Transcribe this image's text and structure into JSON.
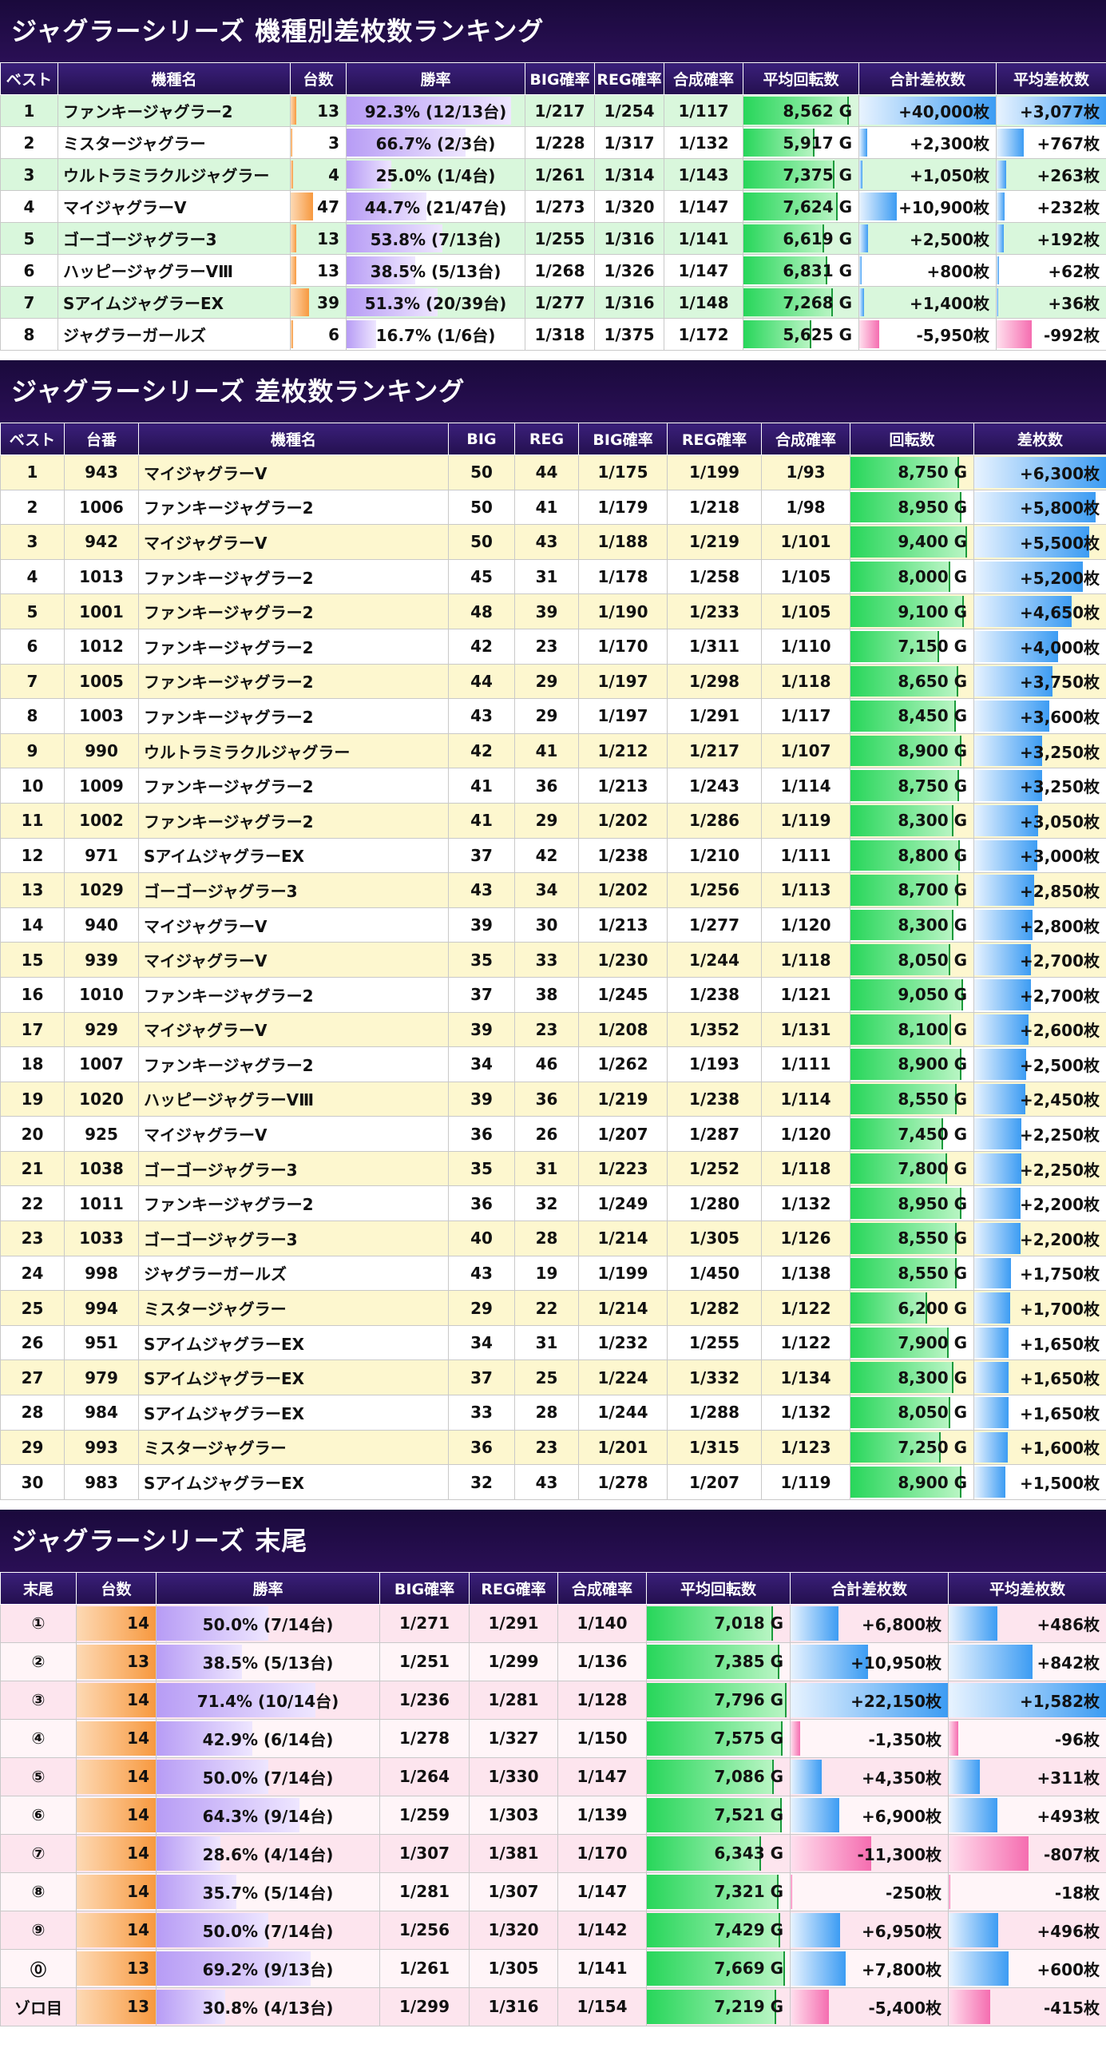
{
  "section1": {
    "title": "ジャグラーシリーズ 機種別差枚数ランキング",
    "headers": [
      "ベスト",
      "機種名",
      "台数",
      "勝率",
      "BIG確率",
      "REG確率",
      "合成確率",
      "平均回転数",
      "合計差枚数",
      "平均差枚数"
    ],
    "rows": [
      {
        "rank": "1",
        "name": "ファンキージャグラー2",
        "count": "13",
        "count_pct": 10,
        "win": "92.3% (12/13台)",
        "win_pct": 92.3,
        "big": "1/217",
        "reg": "1/254",
        "comb": "1/117",
        "avg_spin": "8,562 G",
        "spin_pct": 92,
        "total": "+40,000枚",
        "total_val": 40000,
        "avg": "+3,077枚",
        "avg_val": 3077
      },
      {
        "rank": "2",
        "name": "ミスタージャグラー",
        "count": "3",
        "count_pct": 3,
        "win": "66.7% (2/3台)",
        "win_pct": 66.7,
        "big": "1/228",
        "reg": "1/317",
        "comb": "1/132",
        "avg_spin": "5,917 G",
        "spin_pct": 62,
        "total": "+2,300枚",
        "total_val": 2300,
        "avg": "+767枚",
        "avg_val": 767
      },
      {
        "rank": "3",
        "name": "ウルトラミラクルジャグラー",
        "count": "4",
        "count_pct": 4,
        "win": "25.0% (1/4台)",
        "win_pct": 25,
        "big": "1/261",
        "reg": "1/314",
        "comb": "1/143",
        "avg_spin": "7,375 G",
        "spin_pct": 79,
        "total": "+1,050枚",
        "total_val": 1050,
        "avg": "+263枚",
        "avg_val": 263
      },
      {
        "rank": "4",
        "name": "マイジャグラーV",
        "count": "47",
        "count_pct": 40,
        "win": "44.7% (21/47台)",
        "win_pct": 44.7,
        "big": "1/273",
        "reg": "1/320",
        "comb": "1/147",
        "avg_spin": "7,624 G",
        "spin_pct": 82,
        "total": "+10,900枚",
        "total_val": 10900,
        "avg": "+232枚",
        "avg_val": 232
      },
      {
        "rank": "5",
        "name": "ゴーゴージャグラー3",
        "count": "13",
        "count_pct": 10,
        "win": "53.8% (7/13台)",
        "win_pct": 53.8,
        "big": "1/255",
        "reg": "1/316",
        "comb": "1/141",
        "avg_spin": "6,619 G",
        "spin_pct": 70,
        "total": "+2,500枚",
        "total_val": 2500,
        "avg": "+192枚",
        "avg_val": 192
      },
      {
        "rank": "6",
        "name": "ハッピージャグラーVⅢ",
        "count": "13",
        "count_pct": 10,
        "win": "38.5% (5/13台)",
        "win_pct": 38.5,
        "big": "1/268",
        "reg": "1/326",
        "comb": "1/147",
        "avg_spin": "6,831 G",
        "spin_pct": 73,
        "total": "+800枚",
        "total_val": 800,
        "avg": "+62枚",
        "avg_val": 62
      },
      {
        "rank": "7",
        "name": "SアイムジャグラーEX",
        "count": "39",
        "count_pct": 33,
        "win": "51.3% (20/39台)",
        "win_pct": 51.3,
        "big": "1/277",
        "reg": "1/316",
        "comb": "1/148",
        "avg_spin": "7,268 G",
        "spin_pct": 78,
        "total": "+1,400枚",
        "total_val": 1400,
        "avg": "+36枚",
        "avg_val": 36
      },
      {
        "rank": "8",
        "name": "ジャグラーガールズ",
        "count": "6",
        "count_pct": 5,
        "win": "16.7% (1/6台)",
        "win_pct": 16.7,
        "big": "1/318",
        "reg": "1/375",
        "comb": "1/172",
        "avg_spin": "5,625 G",
        "spin_pct": 59,
        "total": "-5,950枚",
        "total_val": -5950,
        "avg": "-992枚",
        "avg_val": -992
      }
    ]
  },
  "section2": {
    "title": "ジャグラーシリーズ 差枚数ランキング",
    "headers": [
      "ベスト",
      "台番",
      "機種名",
      "BIG",
      "REG",
      "BIG確率",
      "REG確率",
      "合成確率",
      "回転数",
      "差枚数"
    ],
    "rows": [
      {
        "rank": "1",
        "machine": "943",
        "name": "マイジャグラーV",
        "big": "50",
        "reg": "44",
        "bigp": "1/175",
        "regp": "1/199",
        "comb": "1/93",
        "spin": "8,750 G",
        "spin_val": 8750,
        "diff": "+6,300枚",
        "diff_val": 6300
      },
      {
        "rank": "2",
        "machine": "1006",
        "name": "ファンキージャグラー2",
        "big": "50",
        "reg": "41",
        "bigp": "1/179",
        "regp": "1/218",
        "comb": "1/98",
        "spin": "8,950 G",
        "spin_val": 8950,
        "diff": "+5,800枚",
        "diff_val": 5800
      },
      {
        "rank": "3",
        "machine": "942",
        "name": "マイジャグラーV",
        "big": "50",
        "reg": "43",
        "bigp": "1/188",
        "regp": "1/219",
        "comb": "1/101",
        "spin": "9,400 G",
        "spin_val": 9400,
        "diff": "+5,500枚",
        "diff_val": 5500
      },
      {
        "rank": "4",
        "machine": "1013",
        "name": "ファンキージャグラー2",
        "big": "45",
        "reg": "31",
        "bigp": "1/178",
        "regp": "1/258",
        "comb": "1/105",
        "spin": "8,000 G",
        "spin_val": 8000,
        "diff": "+5,200枚",
        "diff_val": 5200
      },
      {
        "rank": "5",
        "machine": "1001",
        "name": "ファンキージャグラー2",
        "big": "48",
        "reg": "39",
        "bigp": "1/190",
        "regp": "1/233",
        "comb": "1/105",
        "spin": "9,100 G",
        "spin_val": 9100,
        "diff": "+4,650枚",
        "diff_val": 4650
      },
      {
        "rank": "6",
        "machine": "1012",
        "name": "ファンキージャグラー2",
        "big": "42",
        "reg": "23",
        "bigp": "1/170",
        "regp": "1/311",
        "comb": "1/110",
        "spin": "7,150 G",
        "spin_val": 7150,
        "diff": "+4,000枚",
        "diff_val": 4000
      },
      {
        "rank": "7",
        "machine": "1005",
        "name": "ファンキージャグラー2",
        "big": "44",
        "reg": "29",
        "bigp": "1/197",
        "regp": "1/298",
        "comb": "1/118",
        "spin": "8,650 G",
        "spin_val": 8650,
        "diff": "+3,750枚",
        "diff_val": 3750
      },
      {
        "rank": "8",
        "machine": "1003",
        "name": "ファンキージャグラー2",
        "big": "43",
        "reg": "29",
        "bigp": "1/197",
        "regp": "1/291",
        "comb": "1/117",
        "spin": "8,450 G",
        "spin_val": 8450,
        "diff": "+3,600枚",
        "diff_val": 3600
      },
      {
        "rank": "9",
        "machine": "990",
        "name": "ウルトラミラクルジャグラー",
        "big": "42",
        "reg": "41",
        "bigp": "1/212",
        "regp": "1/217",
        "comb": "1/107",
        "spin": "8,900 G",
        "spin_val": 8900,
        "diff": "+3,250枚",
        "diff_val": 3250
      },
      {
        "rank": "10",
        "machine": "1009",
        "name": "ファンキージャグラー2",
        "big": "41",
        "reg": "36",
        "bigp": "1/213",
        "regp": "1/243",
        "comb": "1/114",
        "spin": "8,750 G",
        "spin_val": 8750,
        "diff": "+3,250枚",
        "diff_val": 3250
      },
      {
        "rank": "11",
        "machine": "1002",
        "name": "ファンキージャグラー2",
        "big": "41",
        "reg": "29",
        "bigp": "1/202",
        "regp": "1/286",
        "comb": "1/119",
        "spin": "8,300 G",
        "spin_val": 8300,
        "diff": "+3,050枚",
        "diff_val": 3050
      },
      {
        "rank": "12",
        "machine": "971",
        "name": "SアイムジャグラーEX",
        "big": "37",
        "reg": "42",
        "bigp": "1/238",
        "regp": "1/210",
        "comb": "1/111",
        "spin": "8,800 G",
        "spin_val": 8800,
        "diff": "+3,000枚",
        "diff_val": 3000
      },
      {
        "rank": "13",
        "machine": "1029",
        "name": "ゴーゴージャグラー3",
        "big": "43",
        "reg": "34",
        "bigp": "1/202",
        "regp": "1/256",
        "comb": "1/113",
        "spin": "8,700 G",
        "spin_val": 8700,
        "diff": "+2,850枚",
        "diff_val": 2850
      },
      {
        "rank": "14",
        "machine": "940",
        "name": "マイジャグラーV",
        "big": "39",
        "reg": "30",
        "bigp": "1/213",
        "regp": "1/277",
        "comb": "1/120",
        "spin": "8,300 G",
        "spin_val": 8300,
        "diff": "+2,800枚",
        "diff_val": 2800
      },
      {
        "rank": "15",
        "machine": "939",
        "name": "マイジャグラーV",
        "big": "35",
        "reg": "33",
        "bigp": "1/230",
        "regp": "1/244",
        "comb": "1/118",
        "spin": "8,050 G",
        "spin_val": 8050,
        "diff": "+2,700枚",
        "diff_val": 2700
      },
      {
        "rank": "16",
        "machine": "1010",
        "name": "ファンキージャグラー2",
        "big": "37",
        "reg": "38",
        "bigp": "1/245",
        "regp": "1/238",
        "comb": "1/121",
        "spin": "9,050 G",
        "spin_val": 9050,
        "diff": "+2,700枚",
        "diff_val": 2700
      },
      {
        "rank": "17",
        "machine": "929",
        "name": "マイジャグラーV",
        "big": "39",
        "reg": "23",
        "bigp": "1/208",
        "regp": "1/352",
        "comb": "1/131",
        "spin": "8,100 G",
        "spin_val": 8100,
        "diff": "+2,600枚",
        "diff_val": 2600
      },
      {
        "rank": "18",
        "machine": "1007",
        "name": "ファンキージャグラー2",
        "big": "34",
        "reg": "46",
        "bigp": "1/262",
        "regp": "1/193",
        "comb": "1/111",
        "spin": "8,900 G",
        "spin_val": 8900,
        "diff": "+2,500枚",
        "diff_val": 2500
      },
      {
        "rank": "19",
        "machine": "1020",
        "name": "ハッピージャグラーVⅢ",
        "big": "39",
        "reg": "36",
        "bigp": "1/219",
        "regp": "1/238",
        "comb": "1/114",
        "spin": "8,550 G",
        "spin_val": 8550,
        "diff": "+2,450枚",
        "diff_val": 2450
      },
      {
        "rank": "20",
        "machine": "925",
        "name": "マイジャグラーV",
        "big": "36",
        "reg": "26",
        "bigp": "1/207",
        "regp": "1/287",
        "comb": "1/120",
        "spin": "7,450 G",
        "spin_val": 7450,
        "diff": "+2,250枚",
        "diff_val": 2250
      },
      {
        "rank": "21",
        "machine": "1038",
        "name": "ゴーゴージャグラー3",
        "big": "35",
        "reg": "31",
        "bigp": "1/223",
        "regp": "1/252",
        "comb": "1/118",
        "spin": "7,800 G",
        "spin_val": 7800,
        "diff": "+2,250枚",
        "diff_val": 2250
      },
      {
        "rank": "22",
        "machine": "1011",
        "name": "ファンキージャグラー2",
        "big": "36",
        "reg": "32",
        "bigp": "1/249",
        "regp": "1/280",
        "comb": "1/132",
        "spin": "8,950 G",
        "spin_val": 8950,
        "diff": "+2,200枚",
        "diff_val": 2200
      },
      {
        "rank": "23",
        "machine": "1033",
        "name": "ゴーゴージャグラー3",
        "big": "40",
        "reg": "28",
        "bigp": "1/214",
        "regp": "1/305",
        "comb": "1/126",
        "spin": "8,550 G",
        "spin_val": 8550,
        "diff": "+2,200枚",
        "diff_val": 2200
      },
      {
        "rank": "24",
        "machine": "998",
        "name": "ジャグラーガールズ",
        "big": "43",
        "reg": "19",
        "bigp": "1/199",
        "regp": "1/450",
        "comb": "1/138",
        "spin": "8,550 G",
        "spin_val": 8550,
        "diff": "+1,750枚",
        "diff_val": 1750
      },
      {
        "rank": "25",
        "machine": "994",
        "name": "ミスタージャグラー",
        "big": "29",
        "reg": "22",
        "bigp": "1/214",
        "regp": "1/282",
        "comb": "1/122",
        "spin": "6,200 G",
        "spin_val": 6200,
        "diff": "+1,700枚",
        "diff_val": 1700
      },
      {
        "rank": "26",
        "machine": "951",
        "name": "SアイムジャグラーEX",
        "big": "34",
        "reg": "31",
        "bigp": "1/232",
        "regp": "1/255",
        "comb": "1/122",
        "spin": "7,900 G",
        "spin_val": 7900,
        "diff": "+1,650枚",
        "diff_val": 1650
      },
      {
        "rank": "27",
        "machine": "979",
        "name": "SアイムジャグラーEX",
        "big": "37",
        "reg": "25",
        "bigp": "1/224",
        "regp": "1/332",
        "comb": "1/134",
        "spin": "8,300 G",
        "spin_val": 8300,
        "diff": "+1,650枚",
        "diff_val": 1650
      },
      {
        "rank": "28",
        "machine": "984",
        "name": "SアイムジャグラーEX",
        "big": "33",
        "reg": "28",
        "bigp": "1/244",
        "regp": "1/288",
        "comb": "1/132",
        "spin": "8,050 G",
        "spin_val": 8050,
        "diff": "+1,650枚",
        "diff_val": 1650
      },
      {
        "rank": "29",
        "machine": "993",
        "name": "ミスタージャグラー",
        "big": "36",
        "reg": "23",
        "bigp": "1/201",
        "regp": "1/315",
        "comb": "1/123",
        "spin": "7,250 G",
        "spin_val": 7250,
        "diff": "+1,600枚",
        "diff_val": 1600
      },
      {
        "rank": "30",
        "machine": "983",
        "name": "SアイムジャグラーEX",
        "big": "32",
        "reg": "43",
        "bigp": "1/278",
        "regp": "1/207",
        "comb": "1/119",
        "spin": "8,900 G",
        "spin_val": 8900,
        "diff": "+1,500枚",
        "diff_val": 1500
      }
    ]
  },
  "section3": {
    "title": "ジャグラーシリーズ 末尾",
    "headers": [
      "末尾",
      "台数",
      "勝率",
      "BIG確率",
      "REG確率",
      "合成確率",
      "平均回転数",
      "合計差枚数",
      "平均差枚数"
    ],
    "rows": [
      {
        "tail": "①",
        "count": "14",
        "win": "50.0% (7/14台)",
        "win_pct": 50.0,
        "big": "1/271",
        "reg": "1/291",
        "comb": "1/140",
        "spin": "7,018 G",
        "spin_val": 7018,
        "total": "+6,800枚",
        "total_val": 6800,
        "avg": "+486枚",
        "avg_val": 486
      },
      {
        "tail": "②",
        "count": "13",
        "win": "38.5% (5/13台)",
        "win_pct": 38.5,
        "big": "1/251",
        "reg": "1/299",
        "comb": "1/136",
        "spin": "7,385 G",
        "spin_val": 7385,
        "total": "+10,950枚",
        "total_val": 10950,
        "avg": "+842枚",
        "avg_val": 842
      },
      {
        "tail": "③",
        "count": "14",
        "win": "71.4% (10/14台)",
        "win_pct": 71.4,
        "big": "1/236",
        "reg": "1/281",
        "comb": "1/128",
        "spin": "7,796 G",
        "spin_val": 7796,
        "total": "+22,150枚",
        "total_val": 22150,
        "avg": "+1,582枚",
        "avg_val": 1582
      },
      {
        "tail": "④",
        "count": "14",
        "win": "42.9% (6/14台)",
        "win_pct": 42.9,
        "big": "1/278",
        "reg": "1/327",
        "comb": "1/150",
        "spin": "7,575 G",
        "spin_val": 7575,
        "total": "-1,350枚",
        "total_val": -1350,
        "avg": "-96枚",
        "avg_val": -96
      },
      {
        "tail": "⑤",
        "count": "14",
        "win": "50.0% (7/14台)",
        "win_pct": 50.0,
        "big": "1/264",
        "reg": "1/330",
        "comb": "1/147",
        "spin": "7,086 G",
        "spin_val": 7086,
        "total": "+4,350枚",
        "total_val": 4350,
        "avg": "+311枚",
        "avg_val": 311
      },
      {
        "tail": "⑥",
        "count": "14",
        "win": "64.3% (9/14台)",
        "win_pct": 64.3,
        "big": "1/259",
        "reg": "1/303",
        "comb": "1/139",
        "spin": "7,521 G",
        "spin_val": 7521,
        "total": "+6,900枚",
        "total_val": 6900,
        "avg": "+493枚",
        "avg_val": 493
      },
      {
        "tail": "⑦",
        "count": "14",
        "win": "28.6% (4/14台)",
        "win_pct": 28.6,
        "big": "1/307",
        "reg": "1/381",
        "comb": "1/170",
        "spin": "6,343 G",
        "spin_val": 6343,
        "total": "-11,300枚",
        "total_val": -11300,
        "avg": "-807枚",
        "avg_val": -807
      },
      {
        "tail": "⑧",
        "count": "14",
        "win": "35.7% (5/14台)",
        "win_pct": 35.7,
        "big": "1/281",
        "reg": "1/307",
        "comb": "1/147",
        "spin": "7,321 G",
        "spin_val": 7321,
        "total": "-250枚",
        "total_val": -250,
        "avg": "-18枚",
        "avg_val": -18
      },
      {
        "tail": "⑨",
        "count": "14",
        "win": "50.0% (7/14台)",
        "win_pct": 50.0,
        "big": "1/256",
        "reg": "1/320",
        "comb": "1/142",
        "spin": "7,429 G",
        "spin_val": 7429,
        "total": "+6,950枚",
        "total_val": 6950,
        "avg": "+496枚",
        "avg_val": 496
      },
      {
        "tail": "⓪",
        "count": "13",
        "win": "69.2% (9/13台)",
        "win_pct": 69.2,
        "big": "1/261",
        "reg": "1/305",
        "comb": "1/141",
        "spin": "7,669 G",
        "spin_val": 7669,
        "total": "+7,800枚",
        "total_val": 7800,
        "avg": "+600枚",
        "avg_val": 600
      },
      {
        "tail": "ゾロ目",
        "count": "13",
        "win": "30.8% (4/13台)",
        "win_pct": 30.8,
        "big": "1/299",
        "reg": "1/316",
        "comb": "1/154",
        "spin": "7,219 G",
        "spin_val": 7219,
        "total": "-5,400枚",
        "total_val": -5400,
        "avg": "-415枚",
        "avg_val": -415
      }
    ]
  }
}
